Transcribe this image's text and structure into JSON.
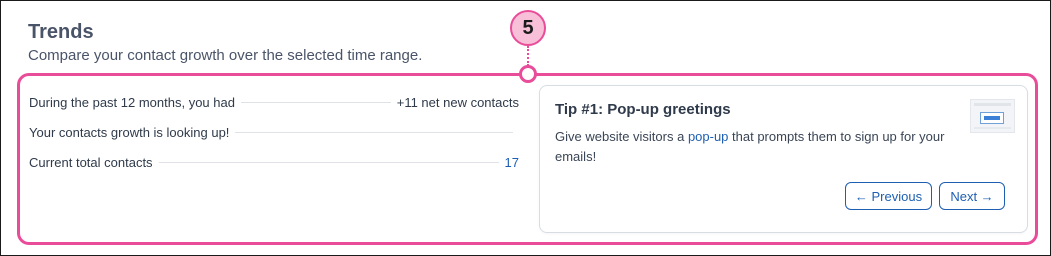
{
  "header": {
    "title": "Trends",
    "subtitle": "Compare your contact growth over the selected time range."
  },
  "callout": {
    "number": "5",
    "color": "#e94c99",
    "fill": "#f8bfd8"
  },
  "stats": [
    {
      "label": "During the past 12 months, you had",
      "value": "+11 net new contacts"
    },
    {
      "label": "Your contacts growth is looking up!",
      "value": ""
    },
    {
      "label": "Current total contacts",
      "value": "17"
    }
  ],
  "tip": {
    "title": "Tip #1: Pop-up greetings",
    "body_before": "Give website visitors a ",
    "body_link": "pop-up",
    "body_after": " that prompts them to sign up for your emails!",
    "thumbnail_icon": "popup-preview-icon",
    "prev_label": "← Previous",
    "next_label": "Next →"
  },
  "colors": {
    "accent": "#1e5fb3",
    "text": "#2f3a4a"
  }
}
